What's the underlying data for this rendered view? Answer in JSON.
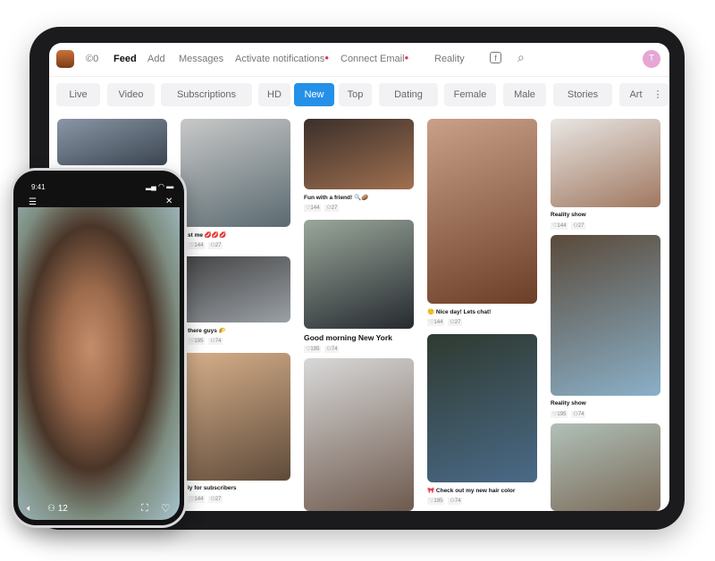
{
  "nav": {
    "coins": "©0",
    "feed": "Feed",
    "add": "Add",
    "messages": "Messages",
    "notifications": "Activate notifications",
    "email": "Connect Email",
    "reality": "Reality",
    "avatar_letter": "T"
  },
  "tabs": [
    "Live",
    "Video",
    "Subscriptions",
    "HD",
    "New",
    "Top",
    "Dating",
    "Female",
    "Male",
    "Stories",
    "Art"
  ],
  "active_tab": "New",
  "colors": {
    "accent": "#2590e8",
    "badge_dot": "#e0334a",
    "avatar": "#e6a6d6"
  },
  "cards": [
    {
      "caption": "",
      "likes": "",
      "views": ""
    },
    {
      "caption": "st me 💋💋💋",
      "likes": "144",
      "views": "27"
    },
    {
      "caption": "there guys 🌮",
      "likes": "195",
      "views": "74"
    },
    {
      "caption": "ly for subscribers",
      "likes": "144",
      "views": "27"
    },
    {
      "caption": "Fun with a friend! 🔍🥔",
      "likes": "144",
      "views": "27"
    },
    {
      "caption": "Good morning New York",
      "likes": "195",
      "views": "74"
    },
    {
      "caption": "",
      "likes": "",
      "views": ""
    },
    {
      "caption": "🙂 Nice day! Lets chat!",
      "likes": "144",
      "views": "27"
    },
    {
      "caption": "🎀 Check out my new hair color",
      "likes": "195",
      "views": "74"
    },
    {
      "caption": "Reality show",
      "likes": "144",
      "views": "27"
    },
    {
      "caption": "Reality show",
      "likes": "195",
      "views": "74"
    },
    {
      "caption": "",
      "likes": "",
      "views": ""
    }
  ],
  "phone": {
    "time": "9:41",
    "viewers": "12"
  }
}
